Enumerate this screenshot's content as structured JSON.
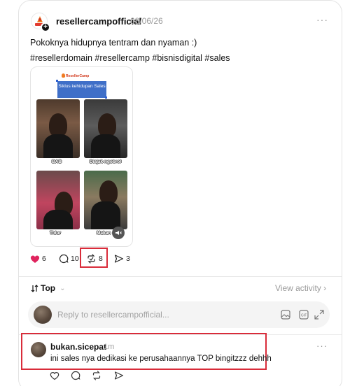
{
  "post": {
    "username": "resellercampofficial",
    "date": "08/06/26",
    "more": "···",
    "text_line1": "Pokoknya hidupnya tentram dan nyaman :)",
    "text_line2": "#resellerdomain #resellercamp #bisnisdigital #sales"
  },
  "media": {
    "brand": "ResellerCamp",
    "title": "Siklus kehidupan Sales",
    "captions": [
      "BAB",
      "Diajak ngobrol",
      "Tidur",
      "Makan"
    ]
  },
  "actions": {
    "likes": "6",
    "replies": "10",
    "reposts": "8",
    "shares": "3",
    "like_color": "#e0245e"
  },
  "sort": {
    "label": "Top"
  },
  "view_activity": "View activity",
  "reply_box": {
    "placeholder": "Reply to resellercampofficial..."
  },
  "comment": {
    "username": "bukan.sicepat",
    "time": "1m",
    "text": "ini sales nya dedikasi ke perusahaannya TOP bingitzzz dehhh",
    "more": "···"
  },
  "accent": "#d92c3a"
}
